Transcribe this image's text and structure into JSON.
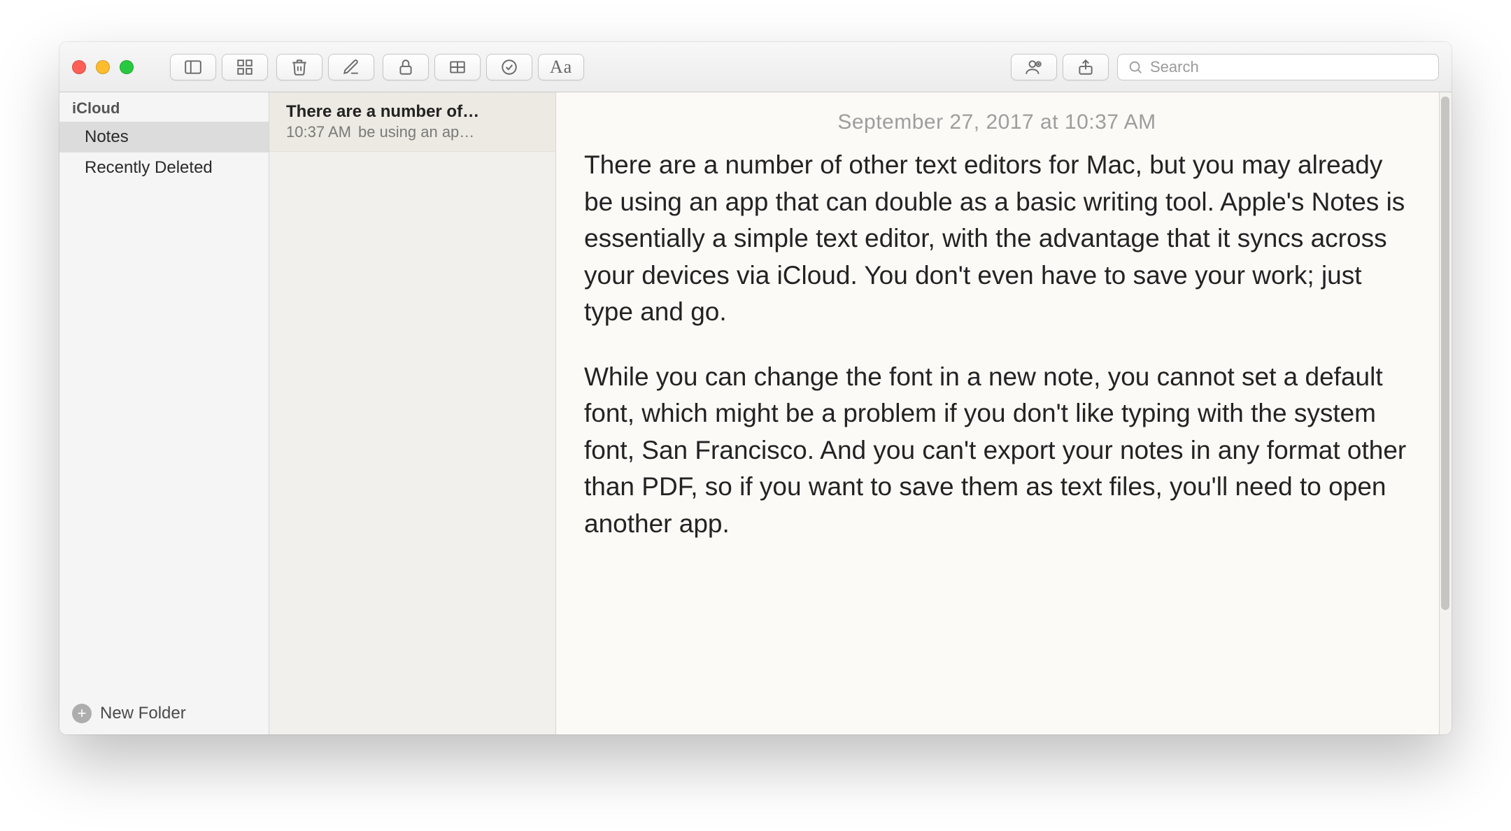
{
  "toolbar": {
    "search_placeholder": "Search",
    "format_label": "Aa"
  },
  "sidebar": {
    "section_label": "iCloud",
    "items": [
      {
        "label": "Notes",
        "selected": true
      },
      {
        "label": "Recently Deleted",
        "selected": false
      }
    ],
    "new_folder_label": "New Folder"
  },
  "notelist": {
    "items": [
      {
        "title": "There are a number of…",
        "time": "10:37 AM",
        "preview": "be using an ap…"
      }
    ]
  },
  "editor": {
    "datetime": "September 27, 2017 at 10:37 AM",
    "paragraphs": [
      "There are a number of other text editors for Mac, but you may already be using an app that can double as a basic writing tool. Apple's Notes is essentially a simple text editor, with the advantage that it syncs across your devices via iCloud. You don't even have to save your work; just type and go.",
      "While you can change the font in a new note, you cannot set a default font, which might be a problem if you don't like typing with the system font, San Francisco. And you can't export your notes in any format other than PDF, so if you want to save them as text files, you'll need to open another app."
    ]
  }
}
